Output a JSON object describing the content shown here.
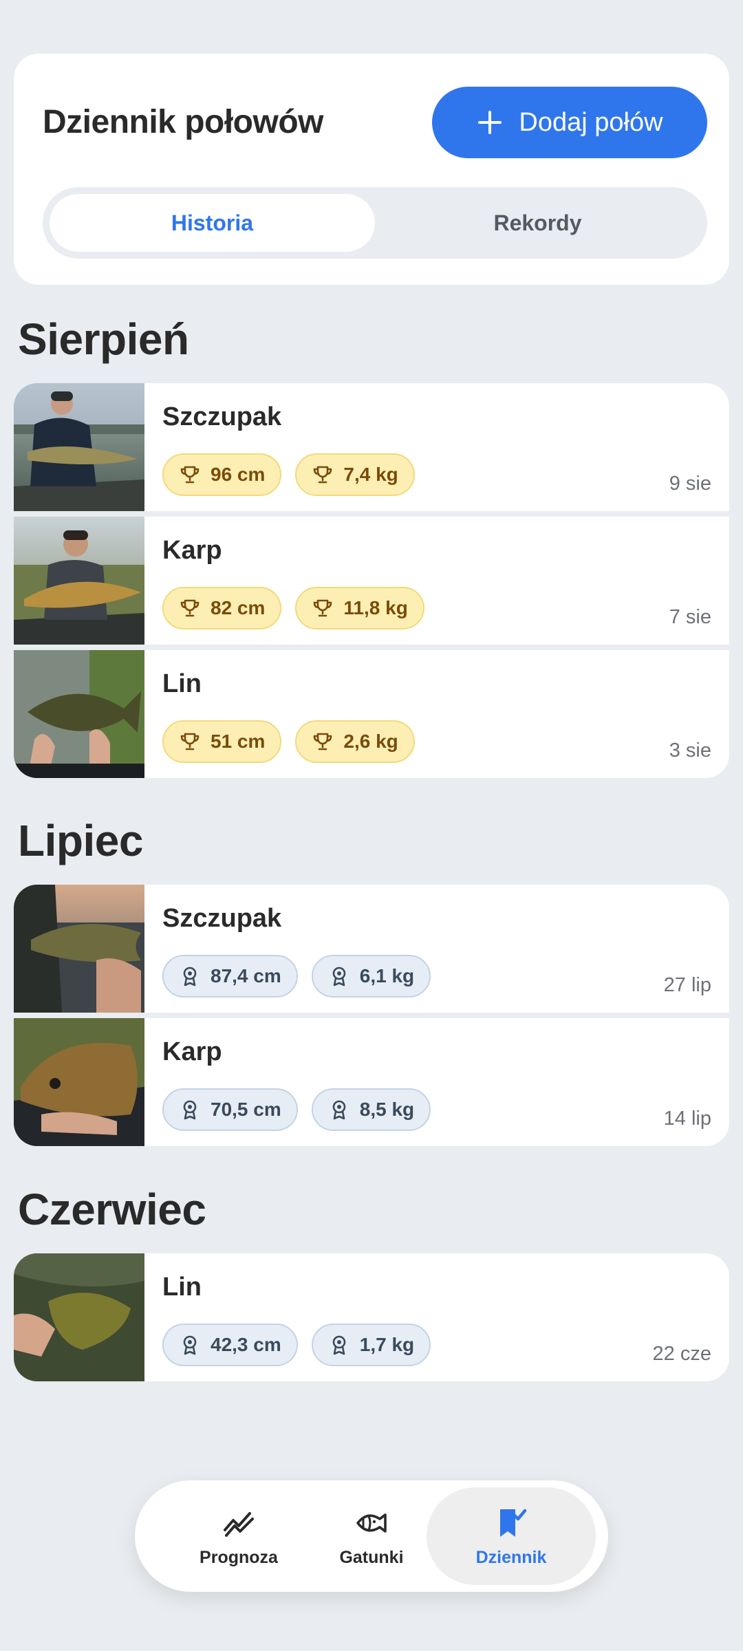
{
  "header": {
    "title": "Dziennik połowów",
    "add_label": "Dodaj połów",
    "tabs": [
      {
        "label": "Historia",
        "active": true
      },
      {
        "label": "Rekordy",
        "active": false
      }
    ]
  },
  "months": [
    {
      "label": "Sierpień",
      "entries": [
        {
          "name": "Szczupak",
          "length": "96 cm",
          "weight": "7,4 kg",
          "date": "9 sie",
          "record": true
        },
        {
          "name": "Karp",
          "length": "82 cm",
          "weight": "11,8 kg",
          "date": "7 sie",
          "record": true
        },
        {
          "name": "Lin",
          "length": "51 cm",
          "weight": "2,6 kg",
          "date": "3 sie",
          "record": true
        }
      ]
    },
    {
      "label": "Lipiec",
      "entries": [
        {
          "name": "Szczupak",
          "length": "87,4 cm",
          "weight": "6,1 kg",
          "date": "27 lip",
          "record": false
        },
        {
          "name": "Karp",
          "length": "70,5 cm",
          "weight": "8,5 kg",
          "date": "14 lip",
          "record": false
        }
      ]
    },
    {
      "label": "Czerwiec",
      "entries": [
        {
          "name": "Lin",
          "length": "42,3 cm",
          "weight": "1,7 kg",
          "date": "22 cze",
          "record": false
        }
      ]
    }
  ],
  "nav": {
    "items": [
      {
        "label": "Prognoza",
        "icon": "forecast-chart-icon",
        "active": false
      },
      {
        "label": "Gatunki",
        "icon": "fish-icon",
        "active": false
      },
      {
        "label": "Dziennik",
        "icon": "bookmark-check-icon",
        "active": true
      }
    ]
  },
  "colors": {
    "accent": "#2f76ec",
    "background": "#e9ecf0",
    "record_badge": "#fdefb4",
    "normal_badge": "#e6edf5"
  }
}
